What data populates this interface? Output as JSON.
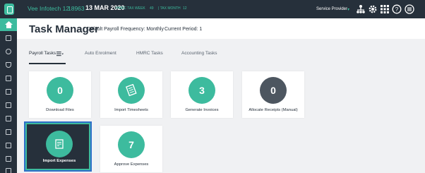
{
  "topbar": {
    "company": "Vee Infotech 12",
    "company_id": "18963",
    "date": "13 MAR 2020",
    "tax_week_label": "HMRC TAX WEEK",
    "tax_week": "49",
    "tax_month_label": "| TAX MONTH",
    "tax_month": "12",
    "provider": "Service Provider",
    "provider_caret": "▾",
    "icons": [
      "org-chart-icon",
      "gear-icon",
      "apps-grid-icon",
      "help-icon",
      "hamburger-menu-icon"
    ]
  },
  "sidebar": {
    "icons": [
      "home-icon",
      "payroll-icon",
      "users-icon",
      "shield-icon",
      "document-icon",
      "document-icon",
      "edit-icon",
      "clipboard-icon",
      "calculator-icon",
      "list-icon",
      "building-icon",
      "file-icon",
      "report-icon"
    ]
  },
  "page": {
    "title": "Task Manager",
    "frequency_label": "Default Payroll Frequency: Monthly",
    "period_label": "Current Period: 1"
  },
  "tabs": [
    {
      "label": "Payroll Tasks",
      "active": true
    },
    {
      "label": "Auto Enrolment",
      "active": false
    },
    {
      "label": "HMRC Tasks",
      "active": false
    },
    {
      "label": "Accounting Tasks",
      "active": false
    }
  ],
  "cards": [
    {
      "label": "Download Files",
      "value": "0",
      "color": "green"
    },
    {
      "label": "Import Timesheets",
      "icon": "timesheet-icon",
      "color": "green"
    },
    {
      "label": "Generate Invoices",
      "value": "3",
      "color": "green"
    },
    {
      "label": "Allocate Receipts (Manual)",
      "value": "0",
      "color": "grey"
    },
    {
      "label": "Import Expenses",
      "icon": "expenses-icon",
      "color": "green",
      "selected": true
    },
    {
      "label": "Approve Expenses",
      "value": "7",
      "color": "green"
    }
  ],
  "colors": {
    "accent": "#3dbb9e",
    "dark": "#26303b",
    "selection": "#2f6fc8"
  }
}
